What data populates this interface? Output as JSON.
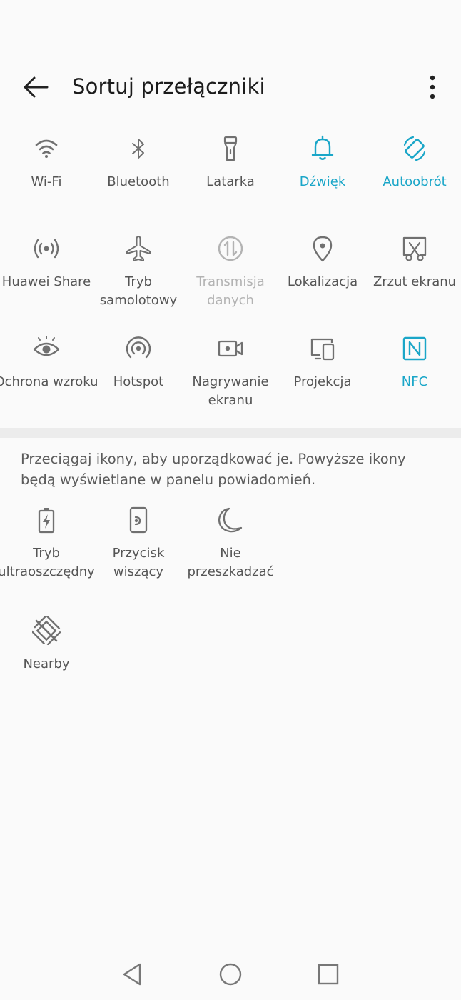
{
  "header": {
    "title": "Sortuj przełączniki"
  },
  "active_tiles": [
    {
      "label": "Wi-Fi",
      "icon": "wifi-icon",
      "state": "normal"
    },
    {
      "label": "Bluetooth",
      "icon": "bluetooth-icon",
      "state": "normal"
    },
    {
      "label": "Latarka",
      "icon": "flashlight-icon",
      "state": "normal"
    },
    {
      "label": "Dźwięk",
      "icon": "bell-icon",
      "state": "active"
    },
    {
      "label": "Autoobrót",
      "icon": "auto-rotate-icon",
      "state": "active"
    },
    {
      "label": "Huawei Share",
      "icon": "huawei-share-icon",
      "state": "normal"
    },
    {
      "label": "Tryb\nsamolotowy",
      "icon": "airplane-icon",
      "state": "normal"
    },
    {
      "label": "Transmisja\ndanych",
      "icon": "mobile-data-icon",
      "state": "disabled"
    },
    {
      "label": "Lokalizacja",
      "icon": "location-pin-icon",
      "state": "normal"
    },
    {
      "label": "Zrzut ekranu",
      "icon": "screenshot-icon",
      "state": "normal"
    },
    {
      "label": "Ochrona wzroku",
      "icon": "eye-icon",
      "state": "normal"
    },
    {
      "label": "Hotspot",
      "icon": "hotspot-icon",
      "state": "normal"
    },
    {
      "label": "Nagrywanie\nekranu",
      "icon": "screen-record-icon",
      "state": "normal"
    },
    {
      "label": "Projekcja",
      "icon": "projection-icon",
      "state": "normal"
    },
    {
      "label": "NFC",
      "icon": "nfc-icon",
      "state": "active"
    }
  ],
  "hint": "Przeciągaj ikony, aby uporządkować je. Powyższe ikony będą wyświetlane w panelu powiadomień.",
  "inactive_tiles": [
    {
      "label": "Tryb\nultraoszczędny",
      "icon": "battery-saver-icon"
    },
    {
      "label": "Przycisk\nwiszący",
      "icon": "floating-button-icon"
    },
    {
      "label": "Nie\nprzeszkadzać",
      "icon": "moon-icon"
    },
    {
      "label": "Nearby",
      "icon": "nearby-icon"
    }
  ],
  "colors": {
    "accent": "#1aa6c8",
    "icon": "#707070",
    "disabled": "#b3b3b3"
  }
}
